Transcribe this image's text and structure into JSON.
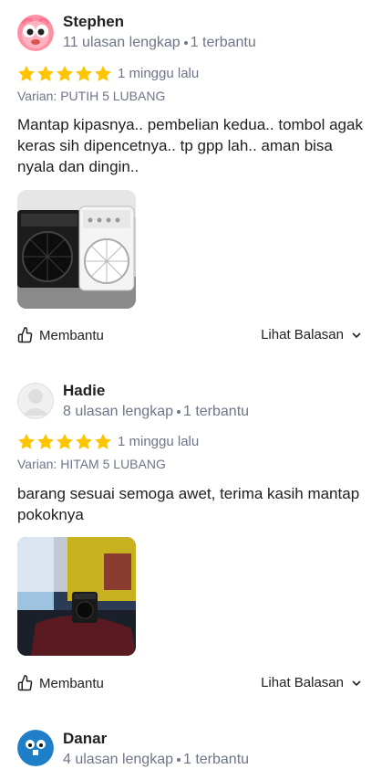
{
  "reviews": [
    {
      "name": "Stephen",
      "review_count": "11 ulasan lengkap",
      "helpful_count": "1 terbantu",
      "rating": 5,
      "time": "1 minggu lalu",
      "variant": "Varian: PUTIH 5 LUBANG",
      "text": "Mantap kipasnya.. pembelian kedua.. tombol agak keras sih dipencetnya.. tp gpp lah.. aman bisa nyala dan dingin..",
      "helpful_label": "Membantu",
      "reply_label": "Lihat Balasan"
    },
    {
      "name": "Hadie",
      "review_count": "8 ulasan lengkap",
      "helpful_count": "1 terbantu",
      "rating": 5,
      "time": "1 minggu lalu",
      "variant": "Varian: HITAM 5 LUBANG",
      "text": "barang sesuai semoga awet, terima kasih mantap pokoknya",
      "helpful_label": "Membantu",
      "reply_label": "Lihat Balasan"
    },
    {
      "name": "Danar",
      "review_count": "4 ulasan lengkap",
      "helpful_count": "1 terbantu"
    }
  ],
  "colors": {
    "star": "#FFC400",
    "muted": "#6d7588",
    "text": "#212121"
  }
}
